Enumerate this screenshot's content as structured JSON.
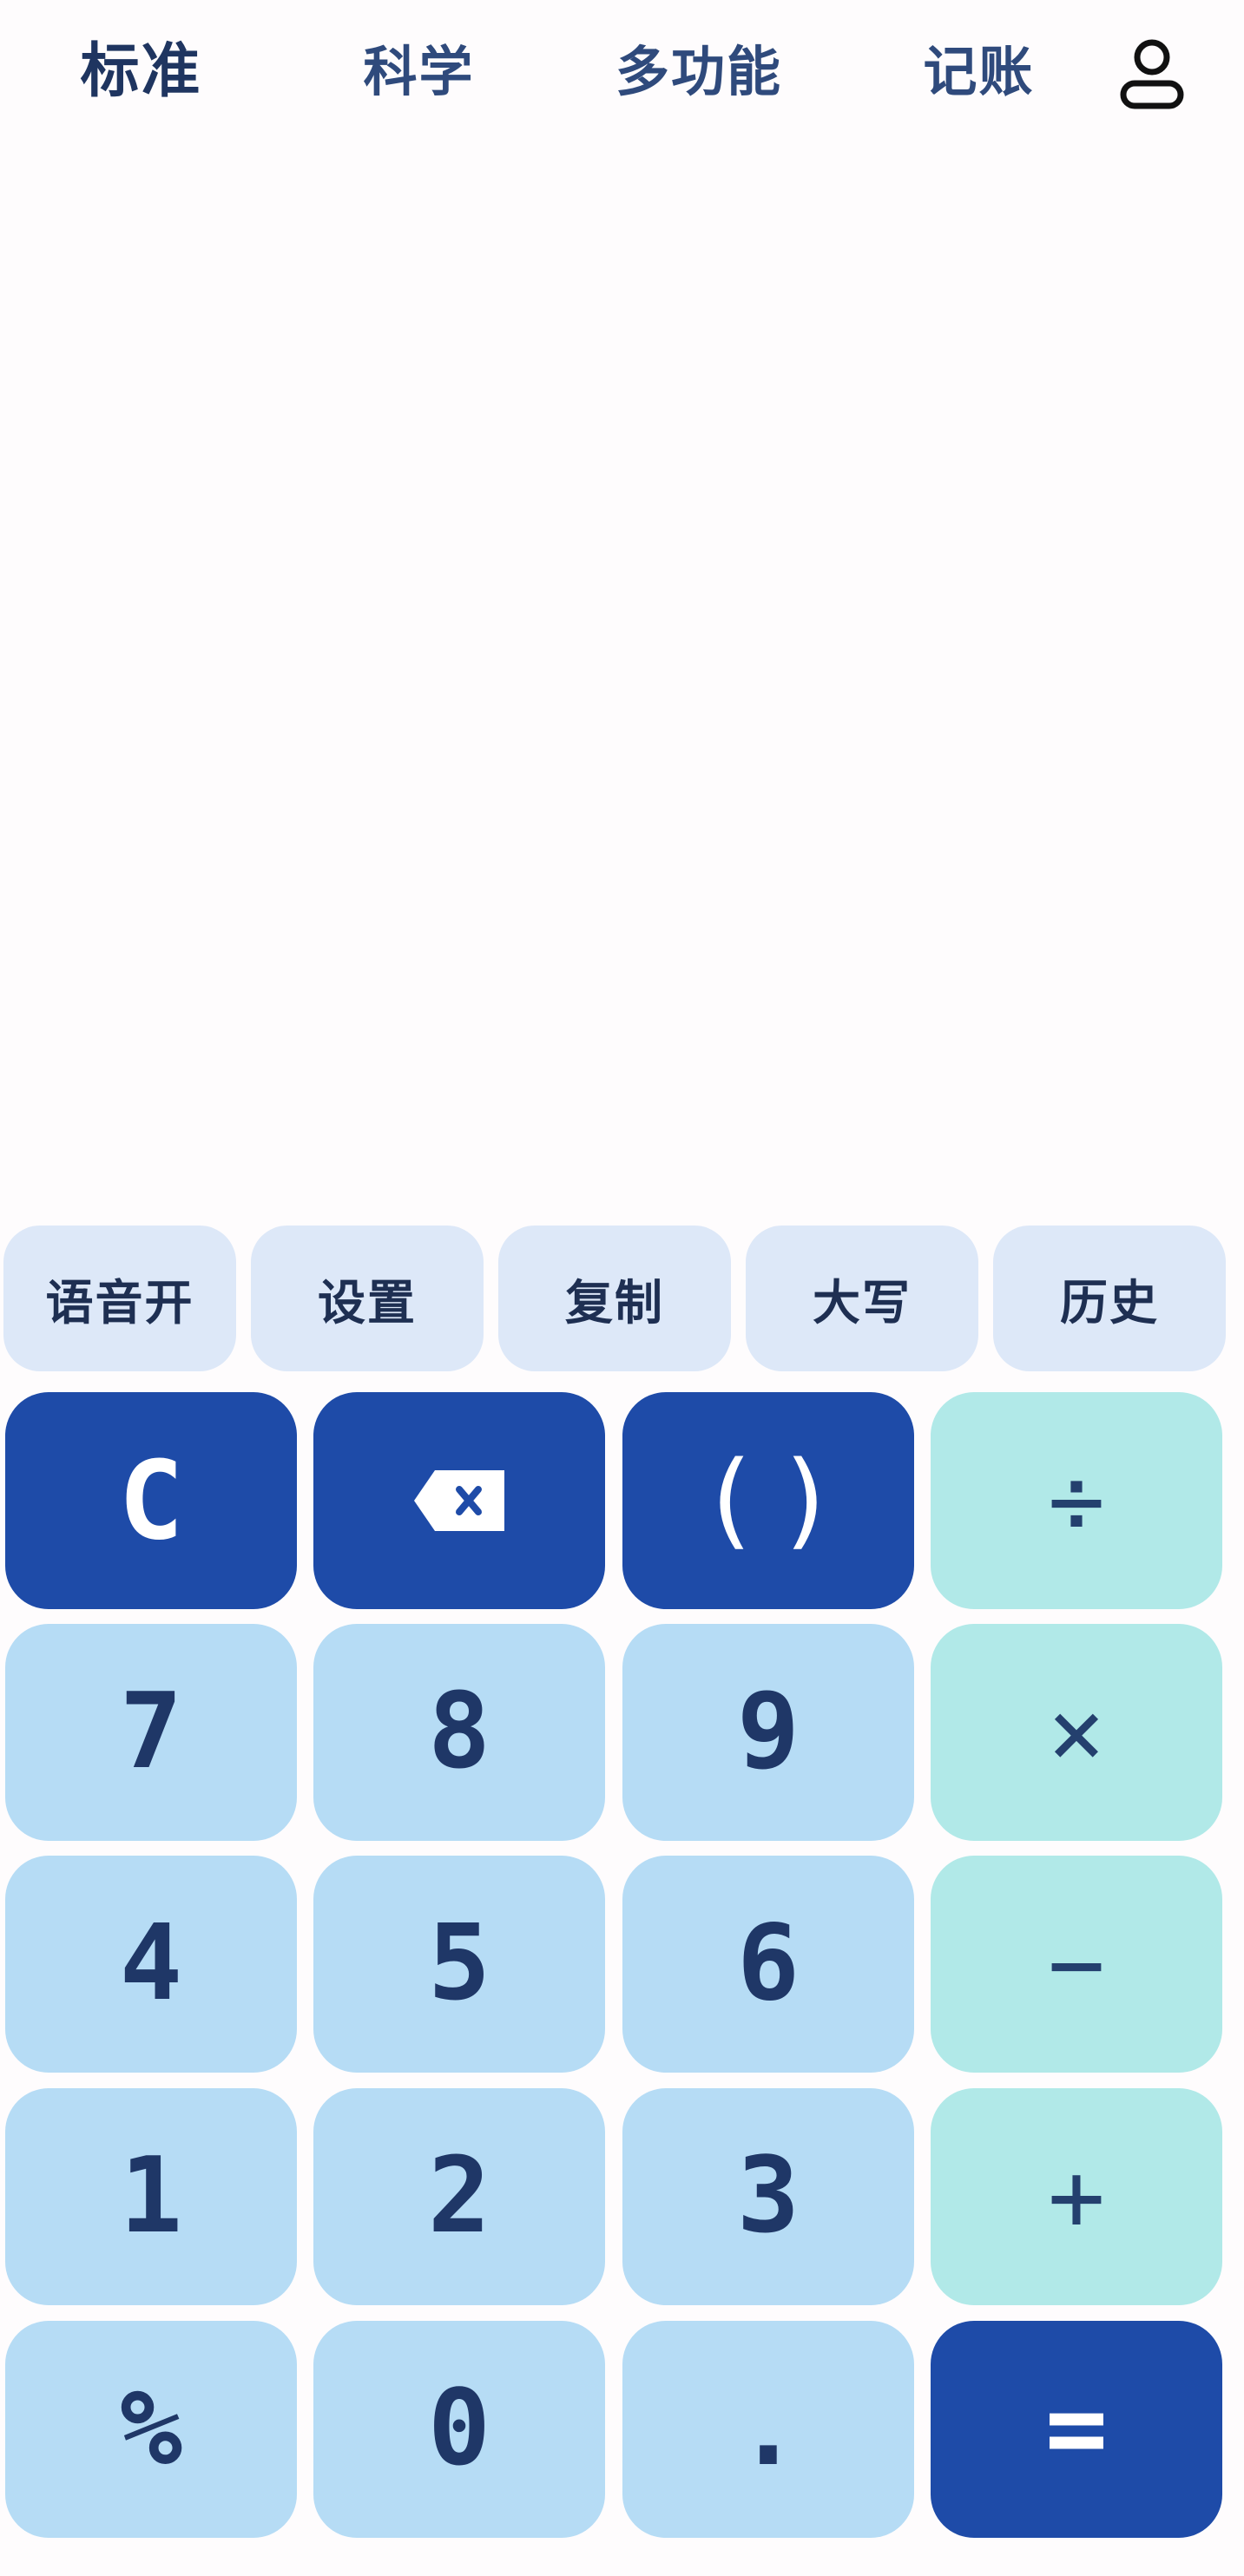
{
  "tabs": [
    {
      "label": "标准",
      "active": true
    },
    {
      "label": "科学",
      "active": false
    },
    {
      "label": "多功能",
      "active": false
    },
    {
      "label": "记账",
      "active": false
    }
  ],
  "header": {
    "user_icon": "user-icon"
  },
  "display": {
    "expression": "",
    "result": ""
  },
  "quick_actions": [
    "语音开",
    "设置",
    "复制",
    "大写",
    "历史"
  ],
  "keypad": {
    "row1": [
      "C",
      "backspace",
      "( )",
      "÷"
    ],
    "row2": [
      "7",
      "8",
      "9",
      "×"
    ],
    "row3": [
      "4",
      "5",
      "6",
      "−"
    ],
    "row4": [
      "1",
      "2",
      "3",
      "+"
    ],
    "row5": [
      "%",
      "0",
      ".",
      "="
    ]
  },
  "colors": {
    "accent": "#1e4ba8",
    "number_key": "#b6dcf5",
    "operator_key": "#b1e9e8",
    "chip": "#dde8f8",
    "text": "#1f3767"
  }
}
